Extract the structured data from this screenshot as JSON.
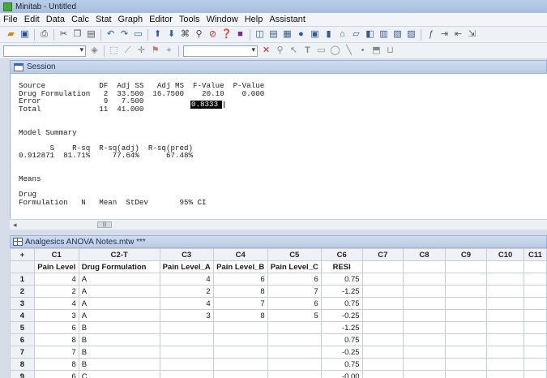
{
  "window": {
    "title": "Minitab - Untitled"
  },
  "menu": [
    "File",
    "Edit",
    "Data",
    "Calc",
    "Stat",
    "Graph",
    "Editor",
    "Tools",
    "Window",
    "Help",
    "Assistant"
  ],
  "session": {
    "title": "Session",
    "output": "Source            DF  Adj SS   Adj MS  F-Value  P-Value\nDrug Formulation   2  33.500  16.7500    20.10    0.000\nError              9   7.500\nTotal             11  41.000\n\n\nModel Summary\n\n       S    R-sq  R-sq(adj)  R-sq(pred)\n0.912871  81.71%     77.64%      67.48%\n\n\nMeans\n\nDrug\nFormulation   N   Mean  StDev       95% CI",
    "selected_value": "0.8333"
  },
  "worksheet": {
    "title": "Analgesics ANOVA Notes.mtw ***",
    "corner": "+",
    "columns": [
      "C1",
      "C2-T",
      "C3",
      "C4",
      "C5",
      "C6",
      "C7",
      "C8",
      "C9",
      "C10",
      "C11"
    ],
    "names": [
      "Pain Level",
      "Drug Formulation",
      "Pain Level_A",
      "Pain Level_B",
      "Pain Level_C",
      "RESI",
      "",
      "",
      "",
      "",
      ""
    ],
    "rows": [
      [
        "1",
        "4",
        "A",
        "4",
        "6",
        "6",
        "0.75"
      ],
      [
        "2",
        "2",
        "A",
        "2",
        "8",
        "7",
        "-1.25"
      ],
      [
        "3",
        "4",
        "A",
        "4",
        "7",
        "6",
        "0.75"
      ],
      [
        "4",
        "3",
        "A",
        "3",
        "8",
        "5",
        "-0.25"
      ],
      [
        "5",
        "6",
        "B",
        "",
        "",
        "",
        "-1.25"
      ],
      [
        "6",
        "8",
        "B",
        "",
        "",
        "",
        "0.75"
      ],
      [
        "7",
        "7",
        "B",
        "",
        "",
        "",
        "-0.25"
      ],
      [
        "8",
        "8",
        "B",
        "",
        "",
        "",
        "0.75"
      ],
      [
        "9",
        "6",
        "C",
        "",
        "",
        "",
        "-0.00"
      ]
    ]
  },
  "colors": {
    "title_bar": "#b9cde8",
    "pane_header": "#c4d4ea",
    "grid_line": "#c9ced6"
  }
}
